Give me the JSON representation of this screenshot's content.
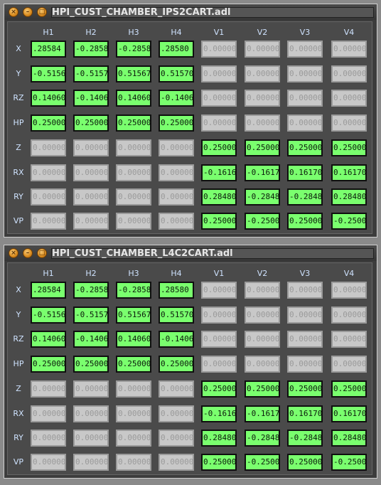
{
  "windows": [
    {
      "title": "HPI_CUST_CHAMBER_IPS2CART.adl",
      "columns": [
        "H1",
        "H2",
        "H3",
        "H4",
        "V1",
        "V2",
        "V3",
        "V4"
      ],
      "rows": [
        {
          "label": "X",
          "cells": [
            ".28584",
            "-0.2858",
            "-0.2858",
            ".28580",
            "0.00000",
            "0.00000",
            "0.00000",
            "0.00000"
          ]
        },
        {
          "label": "Y",
          "cells": [
            "-0.5156",
            "-0.5157",
            "0.51567",
            "0.51570",
            "0.00000",
            "0.00000",
            "0.00000",
            "0.00000"
          ]
        },
        {
          "label": "RZ",
          "cells": [
            "0.14060",
            "-0.1406",
            "0.14060",
            "-0.1406",
            "0.00000",
            "0.00000",
            "0.00000",
            "0.00000"
          ]
        },
        {
          "label": "HP",
          "cells": [
            "0.25000",
            "0.25000",
            "0.25000",
            "0.25000",
            "0.00000",
            "0.00000",
            "0.00000",
            "0.00000"
          ]
        },
        {
          "label": "Z",
          "cells": [
            "0.00000",
            "0.00000",
            "0.00000",
            "0.00000",
            "0.25000",
            "0.25000",
            "0.25000",
            "0.25000"
          ]
        },
        {
          "label": "RX",
          "cells": [
            "0.00000",
            "0.00000",
            "0.00000",
            "0.00000",
            "-0.1616",
            "-0.1617",
            "0.16170",
            "0.16170"
          ]
        },
        {
          "label": "RY",
          "cells": [
            "0.00000",
            "0.00000",
            "0.00000",
            "0.00000",
            "0.28480",
            "-0.2848",
            "-0.2848",
            "0.28480"
          ]
        },
        {
          "label": "VP",
          "cells": [
            "0.00000",
            "0.00000",
            "0.00000",
            "0.00000",
            "0.25000",
            "-0.2500",
            "0.25000",
            "-0.2500"
          ]
        }
      ]
    },
    {
      "title": "HPI_CUST_CHAMBER_L4C2CART.adl",
      "columns": [
        "H1",
        "H2",
        "H3",
        "H4",
        "V1",
        "V2",
        "V3",
        "V4"
      ],
      "rows": [
        {
          "label": "X",
          "cells": ".28584|-0.2858|-0.2858|.28580|0.00000|0.00000|0.00000|0.00000"
        },
        {
          "label": "Y",
          "cells": "-0.5156|-0.5157|0.51567|0.51570|0.00000|0.00000|0.00000|0.00000"
        },
        {
          "label": "RZ",
          "cells": "0.14060|-0.1406|0.14060|-0.1406|0.00000|0.00000|0.00000|0.00000"
        },
        {
          "label": "HP",
          "cells": "0.25000|0.25000|0.25000|0.25000|0.00000|0.00000|0.00000|0.00000"
        },
        {
          "label": "Z",
          "cells": "0.00000|0.00000|0.00000|0.00000|0.25000|0.25000|0.25000|0.25000"
        },
        {
          "label": "RX",
          "cells": "0.00000|0.00000|0.00000|0.00000|-0.1616|-0.1617|0.16170|0.16170"
        },
        {
          "label": "RY",
          "cells": "0.00000|0.00000|0.00000|0.00000|0.28480|-0.2848|-0.2848|0.28480"
        },
        {
          "label": "VP",
          "cells": "0.00000|0.00000|0.00000|0.00000|0.25000|-0.2500|0.25000|-0.2500"
        }
      ]
    }
  ],
  "colors": {
    "active_cell": "#7aff6e",
    "inactive_cell": "#c8c8c8",
    "label_text": "#cfe3ff",
    "background": "#3c3c3c"
  }
}
